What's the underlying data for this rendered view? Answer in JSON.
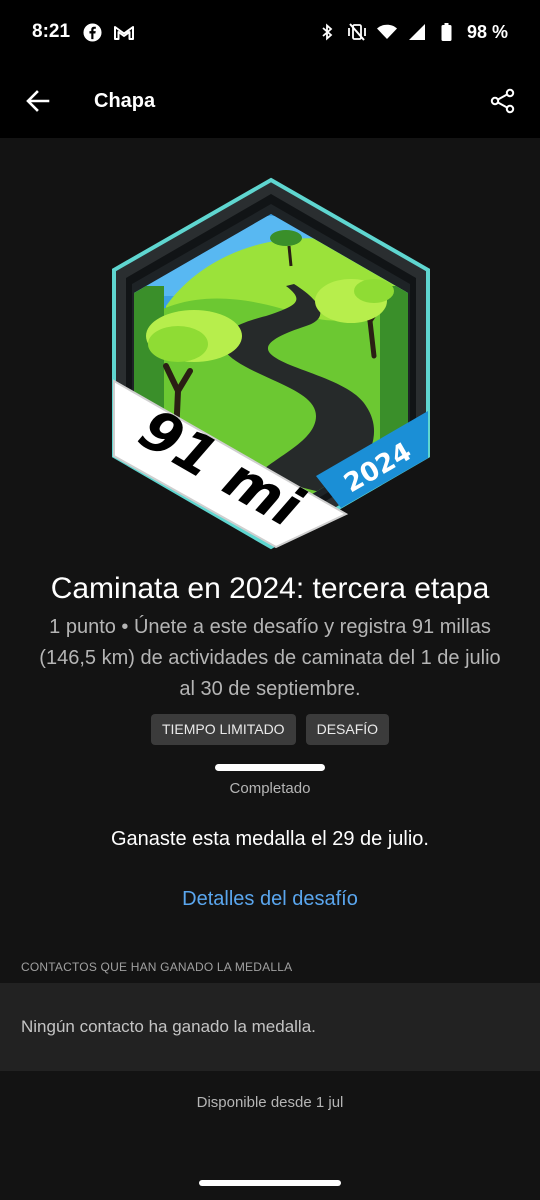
{
  "status_bar": {
    "time": "8:21",
    "battery": "98 %",
    "left_icons": [
      "facebook-icon",
      "gmail-icon"
    ],
    "right_icons": [
      "bluetooth-icon",
      "vibrate-off-icon",
      "wifi-icon",
      "cellular-icon",
      "battery-icon"
    ]
  },
  "app_bar": {
    "title": "Chapa"
  },
  "badge": {
    "distance_text": "91 mi",
    "year_text": "2024",
    "colors": {
      "outer_border": "#5fd6d0",
      "sky": "#3aa0e6",
      "grass_light": "#9be23a",
      "grass_dark": "#3a8f2a",
      "road": "#262a2a",
      "ribbon_white": "#ffffff",
      "ribbon_blue": "#1b8fd6"
    }
  },
  "challenge": {
    "title": "Caminata en 2024: tercera etapa",
    "description": "1 punto • Únete a este desafío y registra 91 millas (146,5 km) de actividades de caminata del 1 de julio al 30 de septiembre.",
    "tags": [
      "TIEMPO LIMITADO",
      "DESAFÍO"
    ],
    "progress_fraction": 1.0,
    "progress_label": "Completado",
    "earned_text": "Ganaste esta medalla el 29 de julio.",
    "details_link": "Detalles del desafío"
  },
  "contacts": {
    "header": "CONTACTOS QUE HAN GANADO LA MEDALLA",
    "empty_text": "Ningún contacto ha ganado la medalla."
  },
  "footer": {
    "available_text": "Disponible desde 1 jul"
  }
}
